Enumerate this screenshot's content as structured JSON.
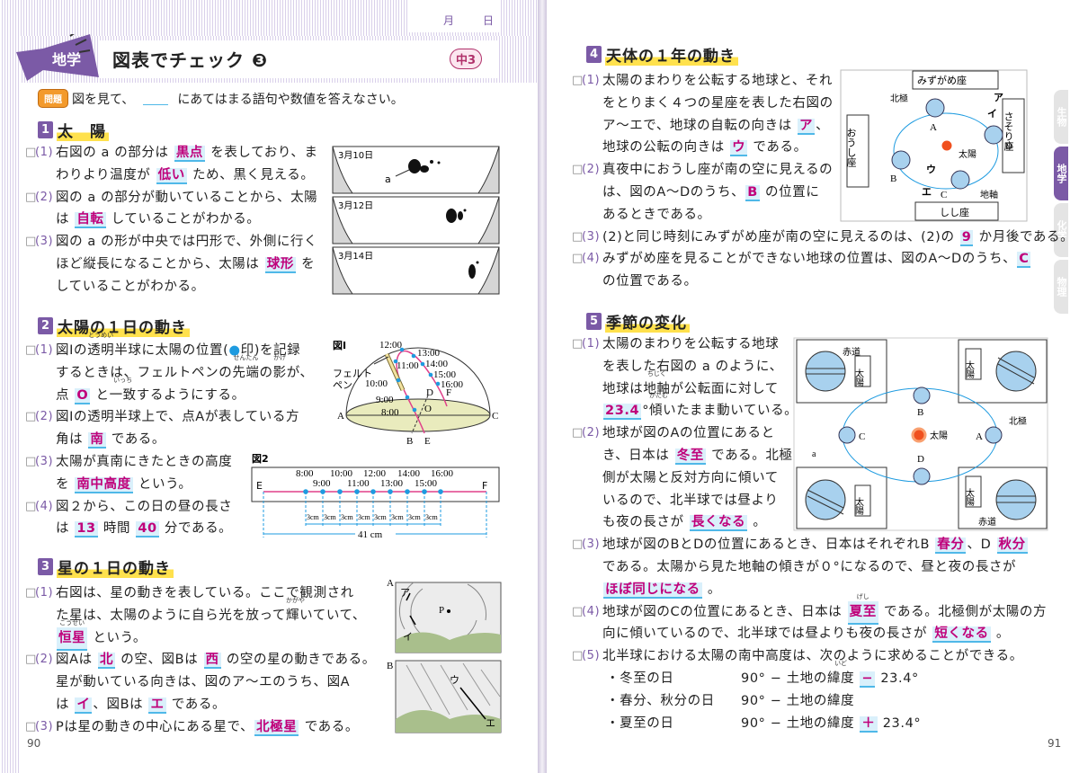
{
  "left_page": {
    "date_box": {
      "month": "月",
      "day": "日"
    },
    "subject_tag": "地学",
    "title": "図表でチェック ❸",
    "grade_badge": "中3",
    "instruction": {
      "badge": "問題",
      "text_before": "図を見て、",
      "text_after": "にあてはまる語句や数値を答えなさい。"
    },
    "page_number": "90"
  },
  "sections": [
    {
      "n": "1",
      "title": "太　陽",
      "items": [
        {
          "num": "(1)",
          "lines": [
            [
              "右図の a の部分は ",
              {
                "a": "黒点"
              },
              " を表しており、ま"
            ],
            [
              "わりより温度が ",
              {
                "a": "低い"
              },
              " ため、黒く見える。"
            ]
          ]
        },
        {
          "num": "(2)",
          "lines": [
            [
              "図の a の部分が動いていることから、太陽"
            ],
            [
              "は ",
              {
                "a": "自転"
              },
              " していることがわかる。"
            ]
          ]
        },
        {
          "num": "(3)",
          "lines": [
            [
              "図の a の形が中央では円形で、外側に行く"
            ],
            [
              "ほど縦長になることから、太陽は ",
              {
                "a": "球形"
              },
              " を"
            ],
            [
              "していることがわかる。"
            ]
          ]
        }
      ]
    },
    {
      "n": "2",
      "title": "太陽の１日の動き",
      "items": [
        {
          "num": "(1)",
          "lines": [
            [
              "図Ⅰの",
              {
                "r": "透明",
                "rt": "とうめい"
              },
              "半球に太陽の位置(",
              {
                "c": "●"
              },
              "印)を記録"
            ],
            [
              "するときは、フェルトペンの",
              {
                "r": "先端",
                "rt": "せんたん"
              },
              "の",
              {
                "r": "影",
                "rt": "かげ"
              },
              "が、"
            ],
            [
              "点 ",
              {
                "a": "O"
              },
              " と",
              {
                "r": "一致",
                "rt": "いっち"
              },
              "するようにする。"
            ]
          ]
        },
        {
          "num": "(2)",
          "lines": [
            [
              "図Ⅰの透明半球上で、点Aが表している方"
            ],
            [
              "角は ",
              {
                "a": "南"
              },
              " である。"
            ]
          ]
        },
        {
          "num": "(3)",
          "lines": [
            [
              "太陽が真南にきたときの高度"
            ],
            [
              "を ",
              {
                "a": "南中高度"
              },
              " という。"
            ]
          ]
        },
        {
          "num": "(4)",
          "lines": [
            [
              "図２から、この日の昼の長さ"
            ],
            [
              "は ",
              {
                "a": "13"
              },
              " 時間 ",
              {
                "a": "40"
              },
              " 分である。"
            ]
          ]
        }
      ]
    },
    {
      "n": "3",
      "title": "星の１日の動き",
      "items": [
        {
          "num": "(1)",
          "lines": [
            [
              "右図は、星の動きを表している。ここで観測され"
            ],
            [
              "た星は、太陽のように自ら光を放って",
              {
                "r": "輝",
                "rt": "かがや"
              },
              "いていて、"
            ],
            [
              {
                "a": "恒星",
                "rt": "こうせい"
              },
              " という。"
            ]
          ]
        },
        {
          "num": "(2)",
          "lines": [
            [
              "図Aは ",
              {
                "a": "北"
              },
              " の空、図Bは ",
              {
                "a": "西"
              },
              " の空の星の動きである。"
            ],
            [
              "星が動いている向きは、図のア〜エのうち、図A"
            ],
            [
              "は ",
              {
                "a": "イ"
              },
              "、図Bは ",
              {
                "a": "エ"
              },
              " である。"
            ]
          ]
        },
        {
          "num": "(3)",
          "lines": [
            [
              "Pは星の動きの中心にある星で、",
              {
                "a": "北極星"
              },
              " である。"
            ]
          ]
        }
      ]
    },
    {
      "n": "4",
      "title": "天体の１年の動き",
      "items": [
        {
          "num": "(1)",
          "lines": [
            [
              "太陽のまわりを公転する地球と、それ"
            ],
            [
              "をとりまく４つの星座を表した右図の"
            ],
            [
              "ア〜エで、地球の自転の向きは ",
              {
                "a": "ア"
              },
              "、"
            ],
            [
              "地球の公転の向きは ",
              {
                "a": "ウ"
              },
              " である。"
            ]
          ]
        },
        {
          "num": "(2)",
          "lines": [
            [
              "真夜中におうし座が南の空に見えるの"
            ],
            [
              "は、図のA〜Dのうち、",
              {
                "a": "B"
              },
              " の位置に"
            ],
            [
              "あるときである。"
            ]
          ]
        },
        {
          "num": "(3)",
          "lines": [
            [
              "(2)と同じ時刻にみずがめ座が南の空に見えるのは、(2)の ",
              {
                "a": "9"
              },
              " か月後である。"
            ]
          ]
        },
        {
          "num": "(4)",
          "lines": [
            [
              "みずがめ座を見ることができない地球の位置は、図のA〜Dのうち、",
              {
                "a": "C"
              }
            ],
            [
              "の位置である。"
            ]
          ]
        }
      ]
    },
    {
      "n": "5",
      "title": "季節の変化",
      "items": [
        {
          "num": "(1)",
          "lines": [
            [
              "太陽のまわりを公転する地球"
            ],
            [
              "を表した右図の a のように、"
            ],
            [
              "地球は",
              {
                "r": "地軸",
                "rt": "ちじく"
              },
              "が公転面に対して"
            ],
            [
              {
                "a": "23.4"
              },
              "°",
              {
                "r": "傾",
                "rt": "かたむ"
              },
              "いたまま動いている。"
            ]
          ]
        },
        {
          "num": "(2)",
          "lines": [
            [
              "地球が図のAの位置にあると"
            ],
            [
              "き、日本は ",
              {
                "a": "冬至"
              },
              " である。北極"
            ],
            [
              "側が太陽と反対方向に傾いて"
            ],
            [
              "いるので、北半球では昼より"
            ],
            [
              "も夜の長さが ",
              {
                "a": "長くなる"
              },
              " 。"
            ]
          ]
        },
        {
          "num": "(3)",
          "lines": [
            [
              "地球が図のBとDの位置にあるとき、日本はそれぞれB ",
              {
                "a": "春分"
              },
              "、D ",
              {
                "a": "秋分"
              }
            ],
            [
              "である。太陽から見た地軸の傾きが０°になるので、昼と夜の長さが"
            ],
            [
              {
                "a": "ほぼ同じになる"
              },
              " 。"
            ]
          ]
        },
        {
          "num": "(4)",
          "lines": [
            [
              "地球が図のCの位置にあるとき、日本は ",
              {
                "a": "夏至",
                "rt": "げし"
              },
              " である。北極側が太陽の方"
            ],
            [
              "向に傾いているので、北半球では昼よりも夜の長さが ",
              {
                "a": "短くなる"
              },
              " 。"
            ]
          ]
        },
        {
          "num": "(5)",
          "lines": [
            [
              "北半球における太陽の南中高度は、次のように求めることができる。"
            ]
          ]
        }
      ],
      "formulas": [
        {
          "label": "・冬至の日",
          "expr": [
            "90° − 土地の",
            {
              "r": "緯度",
              "rt": "いど"
            },
            " ",
            {
              "a": "−"
            },
            " 23.4°"
          ]
        },
        {
          "label": "・春分、秋分の日",
          "expr": [
            "90° − 土地の緯度"
          ]
        },
        {
          "label": "・夏至の日",
          "expr": [
            "90° − 土地の緯度 ",
            {
              "a": "＋"
            },
            " 23.4°"
          ]
        }
      ]
    }
  ],
  "figures": {
    "sunspots": {
      "dates": [
        "3月10日",
        "3月12日",
        "3月14日"
      ],
      "label": "a"
    },
    "fig1": {
      "title": "図Ⅰ",
      "times": [
        "8:00",
        "9:00",
        "10:00",
        "11:00",
        "12:00",
        "13:00",
        "14:00",
        "15:00",
        "16:00"
      ],
      "points": [
        "A",
        "B",
        "C",
        "D",
        "E",
        "F",
        "O"
      ],
      "pen": [
        "フェルト",
        "ペン"
      ]
    },
    "fig2": {
      "title": "図2",
      "ends": [
        "E",
        "F"
      ],
      "interval": "3cm",
      "total": "41 cm"
    },
    "stars": {
      "a": [
        "A",
        "ア",
        "イ",
        "P"
      ],
      "b": [
        "B",
        "ウ",
        "エ"
      ]
    },
    "orbit4": {
      "constellations": [
        "みずがめ座",
        "おうし座",
        "さそり座",
        "しし座"
      ],
      "labels": [
        "北極",
        "ア",
        "イ",
        "ウ",
        "エ",
        "太陽",
        "地軸"
      ],
      "positions": [
        "A",
        "B",
        "C",
        "D"
      ]
    },
    "seasons": {
      "labels": [
        "赤道",
        "太陽",
        "北極",
        "a"
      ],
      "positions": [
        "A",
        "B",
        "C",
        "D"
      ]
    }
  },
  "right_page": {
    "page_number": "91",
    "tabs": [
      {
        "label": "生物",
        "active": false
      },
      {
        "label": "地学",
        "active": true
      },
      {
        "label": "化学",
        "active": false
      },
      {
        "label": "物理",
        "active": false
      }
    ]
  },
  "colors": {
    "accent": "#7b5aa6",
    "answer": "#c0007a",
    "answer_bg": "#daf0fb",
    "highlight": "#ffe14d",
    "dot": "#1e9be0"
  }
}
